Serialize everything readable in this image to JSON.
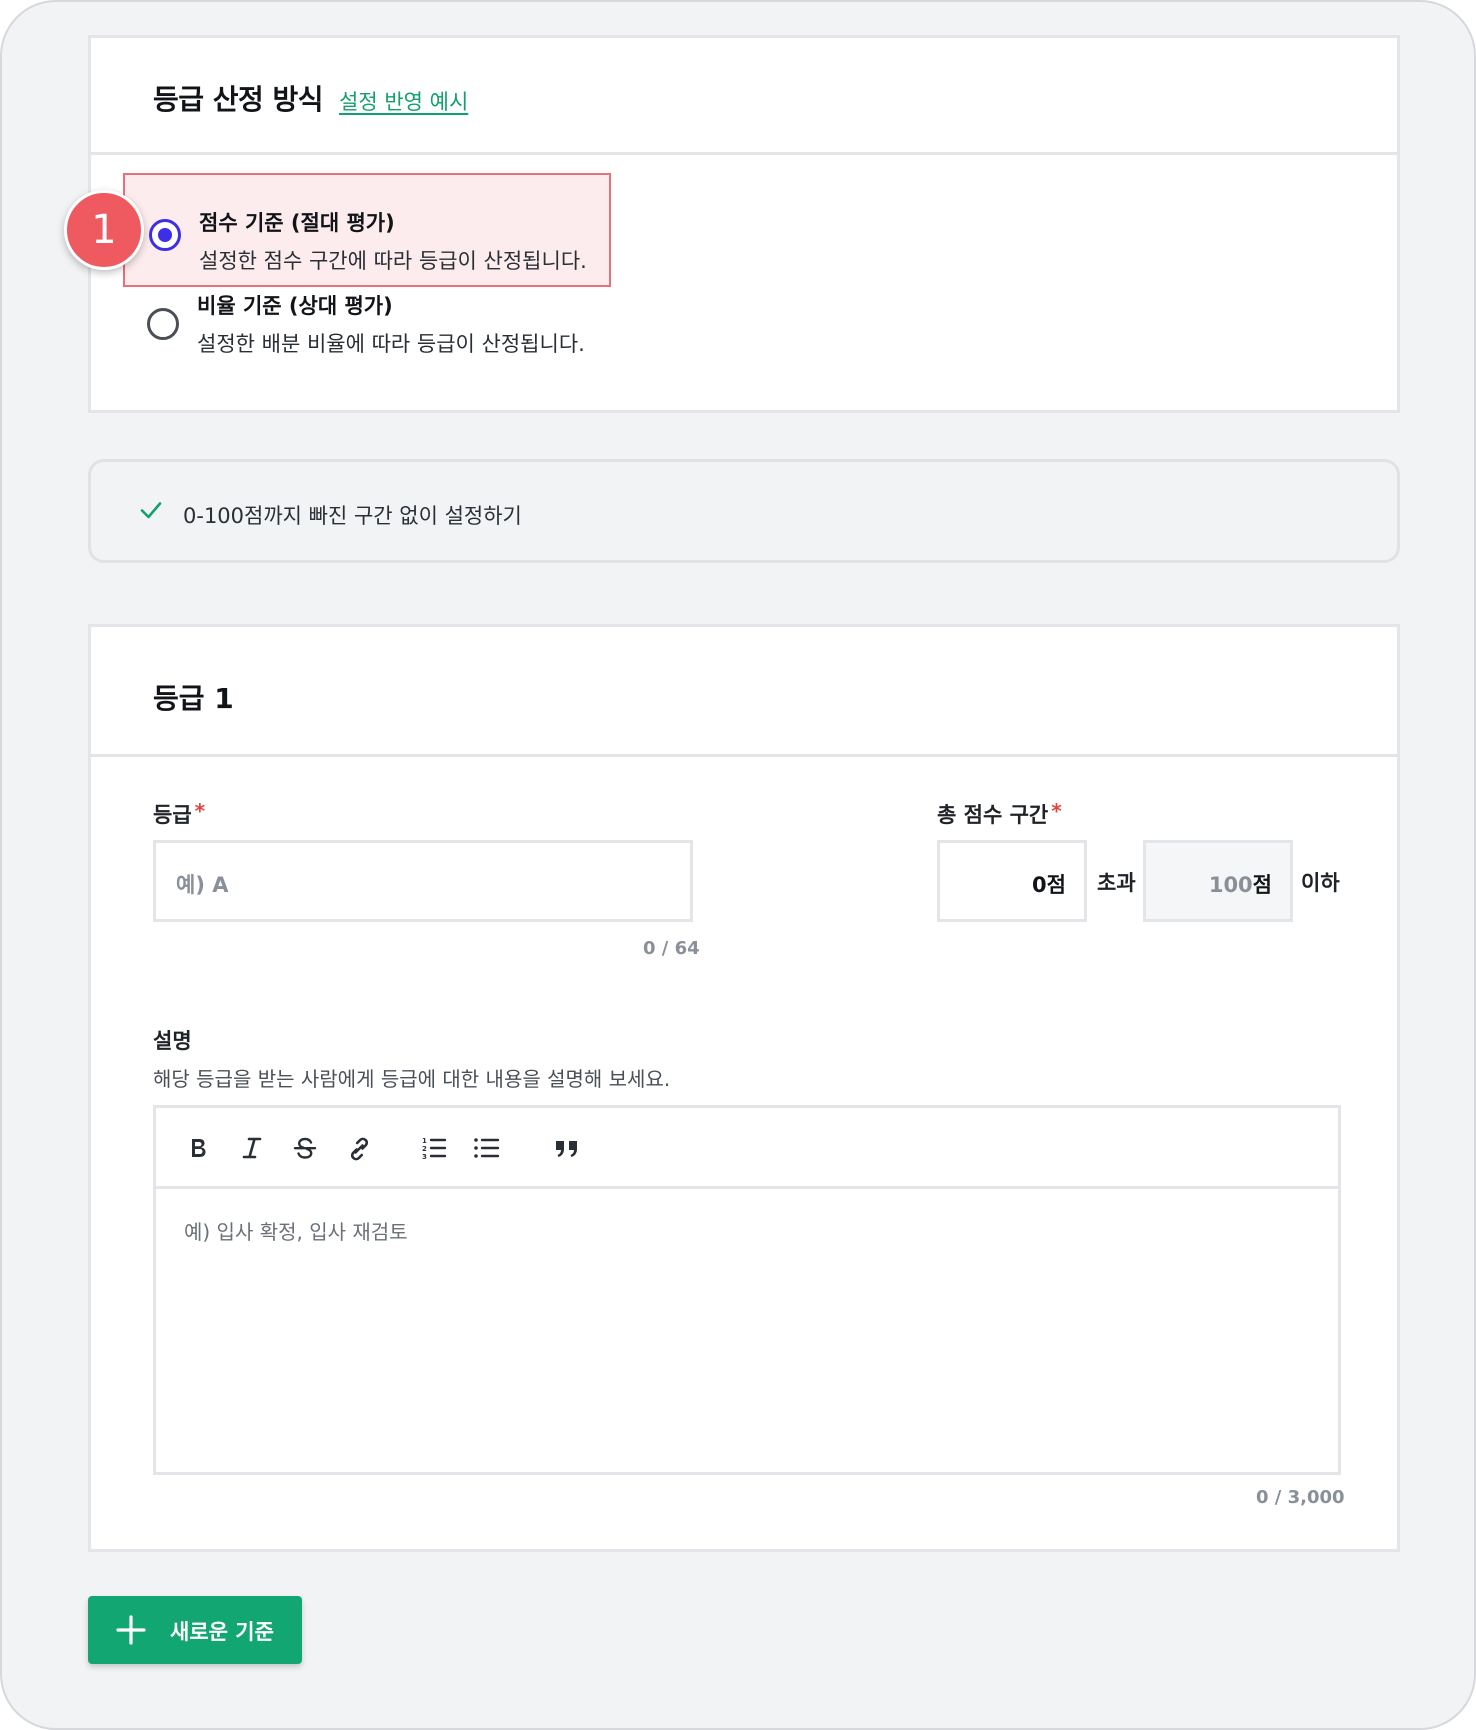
{
  "method_section": {
    "title": "등급 산정 방식",
    "example_link": "설정 반영 예시",
    "options": [
      {
        "title": "점수 기준 (절대 평가)",
        "description": "설정한 점수 구간에 따라 등급이 산정됩니다.",
        "selected": true
      },
      {
        "title": "비율 기준 (상대 평가)",
        "description": "설정한 배분 비율에 따라 등급이 산정됩니다.",
        "selected": false
      }
    ],
    "step_badge": "1",
    "accent_color": "#3d2ee8",
    "highlight_color": "#e8707a"
  },
  "check_row": {
    "icon": "check-icon",
    "text": "0-100점까지 빠진 구간 없이 설정하기",
    "color": "#12a06b"
  },
  "grade_card": {
    "title": "등급 1",
    "grade_field": {
      "label": "등급",
      "required_mark": "*",
      "placeholder": "예) A",
      "counter": "0 / 64"
    },
    "score_range": {
      "label": "총 점수 구간",
      "required_mark": "*",
      "min_value": "0",
      "max_value": "100",
      "unit": "점",
      "exceed_word": "초과",
      "below_word": "이하"
    },
    "description_field": {
      "label": "설명",
      "help": "해당 등급을 받는 사람에게 등급에 대한 내용을 설명해 보세요.",
      "toolbar": [
        "bold-icon",
        "italic-icon",
        "strikethrough-icon",
        "link-icon",
        "ordered-list-icon",
        "bullet-list-icon",
        "quote-icon"
      ],
      "placeholder": "예) 입사 확정, 입사 재검토",
      "counter": "0 / 3,000"
    }
  },
  "new_criteria_button": {
    "icon": "plus-icon",
    "label": "새로운 기준",
    "color": "#12a673"
  }
}
